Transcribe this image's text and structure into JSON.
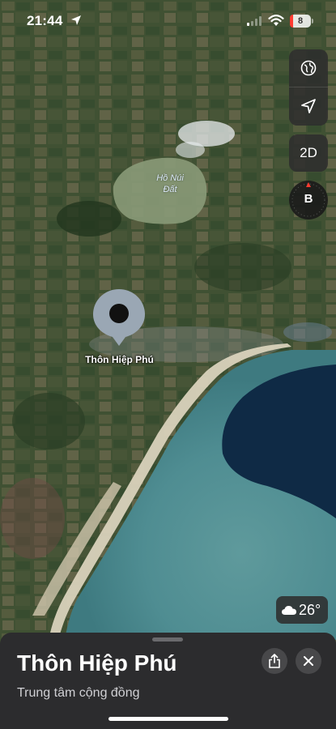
{
  "status_bar": {
    "time": "21:44",
    "battery_level": "8",
    "battery_color": "#ff3b30",
    "icons": [
      "location-arrow-icon",
      "signal-icon",
      "wifi-icon",
      "battery-icon"
    ]
  },
  "map": {
    "lake_label_line1": "Hồ Núi",
    "lake_label_line2": "Đất",
    "pin_label": "Thôn Hiệp Phú",
    "pin_color": "#9aa7b4"
  },
  "controls": {
    "globe_icon": "globe-icon",
    "location_icon": "location-arrow-icon",
    "view_mode_label": "2D",
    "compass_letter": "B"
  },
  "weather": {
    "icon": "cloud-icon",
    "temperature": "26°"
  },
  "sheet": {
    "title": "Thôn Hiệp Phú",
    "subtitle": "Trung tâm cộng đồng",
    "share_icon": "share-icon",
    "close_icon": "close-icon"
  }
}
